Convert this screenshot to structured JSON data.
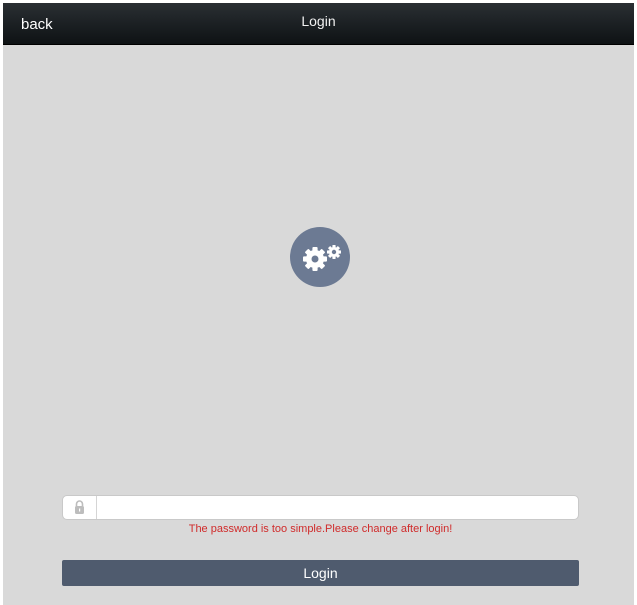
{
  "header": {
    "back_label": "back",
    "title": "Login"
  },
  "logo": {
    "icon": "gears-icon",
    "circle_color": "#6c7a93"
  },
  "password": {
    "icon": "lock-icon",
    "value": "",
    "placeholder": ""
  },
  "warning": {
    "text": "The password is too simple.Please change after login!",
    "color": "#d02b2b"
  },
  "login_button": {
    "label": "Login",
    "color": "#4f5b6e"
  }
}
